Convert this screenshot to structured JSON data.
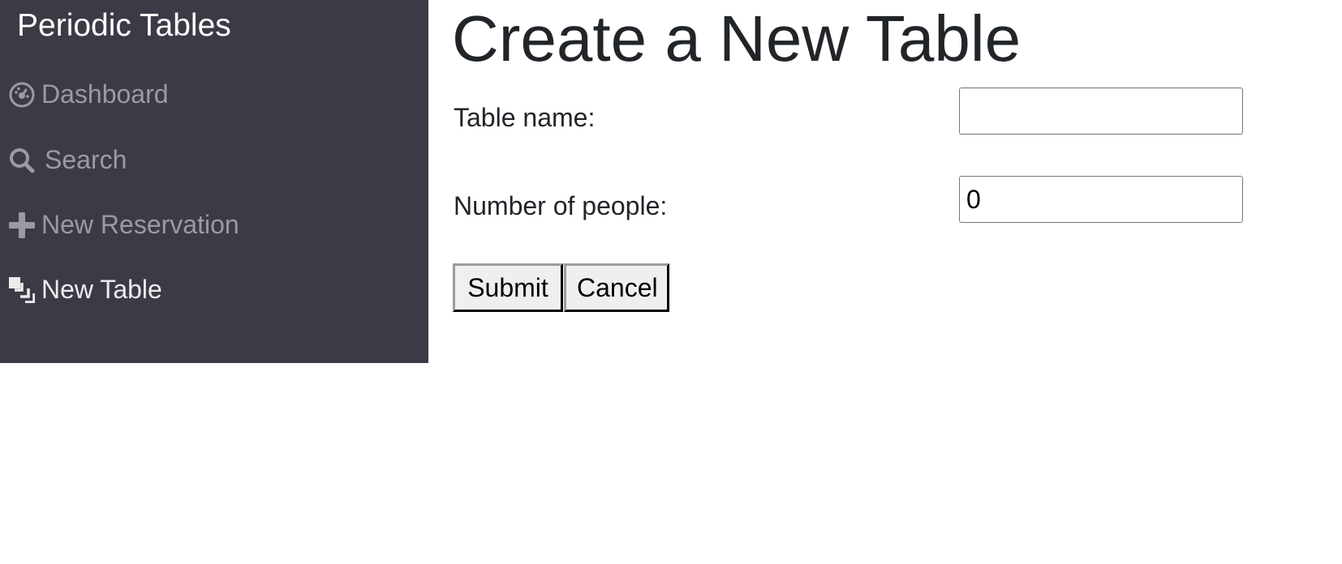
{
  "sidebar": {
    "brand": "Periodic Tables",
    "items": [
      {
        "label": "Dashboard",
        "icon": "dashboard-icon"
      },
      {
        "label": "Search",
        "icon": "search-icon"
      },
      {
        "label": "New Reservation",
        "icon": "plus-icon"
      },
      {
        "label": "New Table",
        "icon": "layers-icon",
        "active": true
      }
    ],
    "background": "#3b3b46"
  },
  "main": {
    "title": "Create a New Table",
    "form": {
      "table_name_label": "Table name:",
      "table_name_value": "",
      "people_label": "Number of people:",
      "people_value": "0",
      "submit_label": "Submit",
      "cancel_label": "Cancel"
    }
  }
}
